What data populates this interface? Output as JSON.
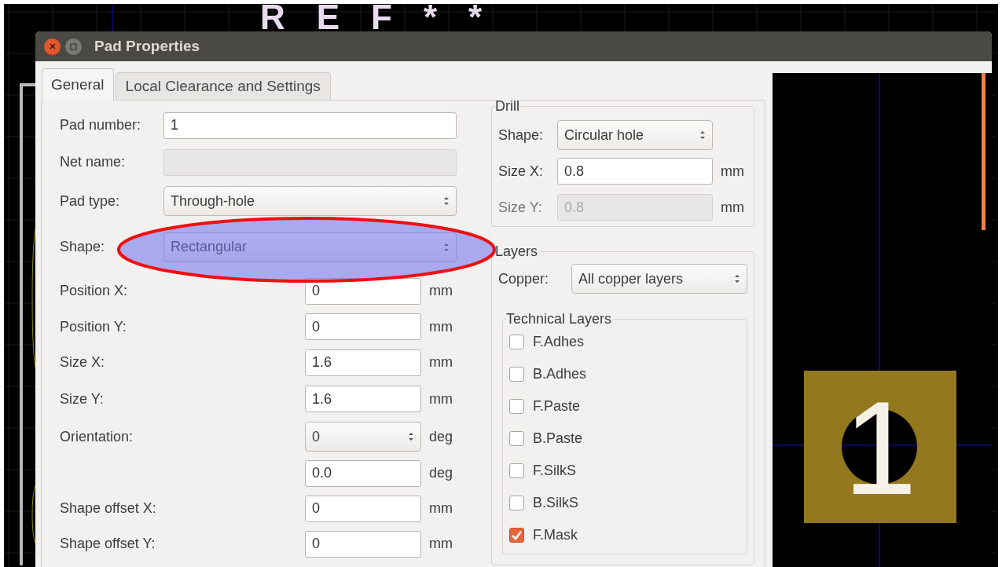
{
  "canvas": {
    "reference_text": "REF**"
  },
  "window": {
    "title": "Pad Properties"
  },
  "tabs": [
    {
      "label": "General",
      "selected": true
    },
    {
      "label": "Local Clearance and Settings",
      "selected": false
    }
  ],
  "general": {
    "fields": [
      {
        "label": "Pad number:",
        "kind": "text",
        "value": "1",
        "disabled": false
      },
      {
        "label": "Net name:",
        "kind": "text",
        "disabled": true
      },
      {
        "label": "Pad type:",
        "kind": "combo",
        "value": "Through-hole"
      },
      {
        "label": "Shape:",
        "kind": "combo",
        "value": "Rectangular"
      },
      {
        "label": "Position X:",
        "kind": "number",
        "value": "0",
        "unit": "mm"
      },
      {
        "label": "Position Y:",
        "kind": "number",
        "value": "0",
        "unit": "mm"
      },
      {
        "label": "Size X:",
        "kind": "number",
        "value": "1.6",
        "unit": "mm"
      },
      {
        "label": "Size Y:",
        "kind": "number",
        "value": "1.6",
        "unit": "mm"
      },
      {
        "label": "Orientation:",
        "kind": "spin",
        "value": "0",
        "unit": "deg"
      },
      {
        "kind": "number",
        "value": "0.0",
        "unit": "deg"
      },
      {
        "label": "Shape offset X:",
        "kind": "number",
        "value": "0",
        "unit": "mm"
      },
      {
        "label": "Shape offset Y:",
        "kind": "number",
        "value": "0",
        "unit": "mm"
      }
    ]
  },
  "drill": {
    "title": "Drill",
    "fields": [
      {
        "label": "Shape:",
        "kind": "combo",
        "value": "Circular hole"
      },
      {
        "label": "Size X:",
        "kind": "number",
        "value": "0.8",
        "unit": "mm",
        "disabled": false
      },
      {
        "label": "Size Y:",
        "kind": "number",
        "value": "0.8",
        "unit": "mm",
        "disabled": true
      }
    ]
  },
  "layers": {
    "title": "Layers",
    "copper": {
      "label": "Copper:",
      "value": "All copper layers"
    },
    "technical": {
      "title": "Technical Layers",
      "items": [
        {
          "label": "F.Adhes",
          "checked": false
        },
        {
          "label": "B.Adhes",
          "checked": false
        },
        {
          "label": "F.Paste",
          "checked": false
        },
        {
          "label": "B.Paste",
          "checked": false
        },
        {
          "label": "F.SilkS",
          "checked": false
        },
        {
          "label": "B.SilkS",
          "checked": false
        },
        {
          "label": "F.Mask",
          "checked": true
        }
      ]
    }
  },
  "preview": {
    "pad_number": "1"
  }
}
